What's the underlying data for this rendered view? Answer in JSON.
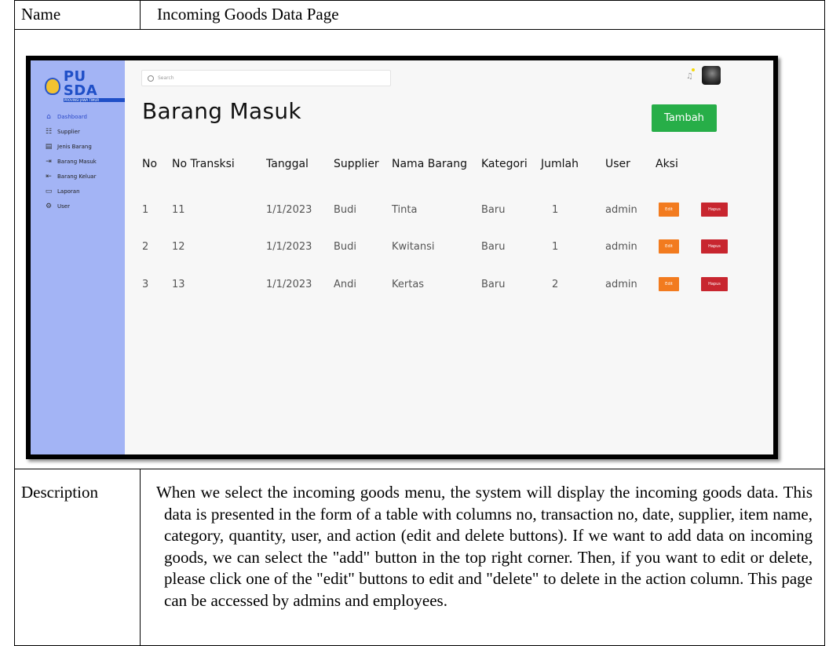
{
  "doc": {
    "name_label": "Name",
    "name_value": "Incoming Goods Data Page",
    "description_label": "Description",
    "description_text": "When we select the incoming goods menu, the system will display the incoming goods data. This data is presented in the form of a table with columns no, transaction no, date, supplier, item name, category, quantity, user, and action (edit and delete buttons). If we want to add data on incoming goods, we can select the \"add\" button in the top right corner. Then, if you want to edit or delete, please click one of the \"edit\" buttons to edit and \"delete\" to delete in the action column. This page can be accessed by admins and employees."
  },
  "app": {
    "logo": {
      "title": "PU SDA",
      "subtitle": "PROVINSI JAWA TIMUR"
    },
    "sidebar": {
      "items": [
        {
          "label": "Dashboard",
          "icon": "home-icon",
          "active": true
        },
        {
          "label": "Supplier",
          "icon": "network-icon",
          "active": false
        },
        {
          "label": "Jenis Barang",
          "icon": "boxes-icon",
          "active": false
        },
        {
          "label": "Barang Masuk",
          "icon": "login-icon",
          "active": false
        },
        {
          "label": "Barang Keluar",
          "icon": "logout-icon",
          "active": false
        },
        {
          "label": "Laporan",
          "icon": "report-icon",
          "active": false
        },
        {
          "label": "User",
          "icon": "gear-icon",
          "active": false
        }
      ]
    },
    "search": {
      "placeholder": "Search"
    },
    "header": {
      "title": "Barang Masuk",
      "add_button": "Tambah"
    },
    "table": {
      "columns": [
        "No",
        "No Transksi",
        "Tanggal",
        "Supplier",
        "Nama Barang",
        "Kategori",
        "Jumlah",
        "User",
        "Aksi"
      ],
      "rows": [
        [
          "1",
          "11",
          "1/1/2023",
          "Budi",
          "Tinta",
          "Baru",
          "1",
          "admin"
        ],
        [
          "2",
          "12",
          "1/1/2023",
          "Budi",
          "Kwitansi",
          "Baru",
          "1",
          "admin"
        ],
        [
          "3",
          "13",
          "1/1/2023",
          "Andi",
          "Kertas",
          "Baru",
          "2",
          "admin"
        ]
      ],
      "edit_label": "Edit",
      "delete_label": "Hapus"
    },
    "colors": {
      "sidebar": "#a3b4f5",
      "add_button": "#27ae48",
      "edit_button": "#f27b1f",
      "delete_button": "#c8262f"
    }
  }
}
